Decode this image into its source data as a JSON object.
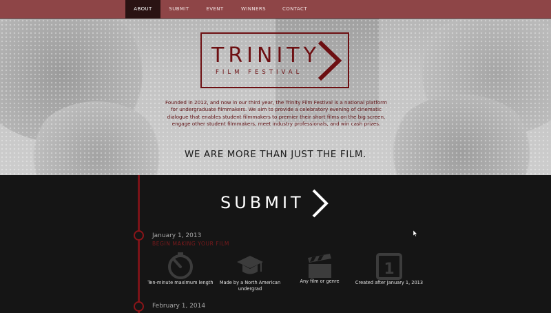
{
  "nav": {
    "items": [
      {
        "label": "ABOUT",
        "active": true
      },
      {
        "label": "SUBMIT",
        "active": false
      },
      {
        "label": "EVENT",
        "active": false
      },
      {
        "label": "WINNERS",
        "active": false
      },
      {
        "label": "CONTACT",
        "active": false
      }
    ]
  },
  "hero": {
    "logo_title": "TRINITY",
    "logo_subtitle": "FILM FESTIVAL",
    "description": "Founded in 2012, and now in our third year, the Trinity Film Festival is a national platform for undergraduate filmmakers. We aim to provide a celebratory evening of cinematic dialogue that enables student filmmakers to premier their short films on the big screen, engage other student filmmakers, meet industry professionals, and win cash prizes.",
    "tagline": "WE ARE MORE THAN JUST THE FILM."
  },
  "submit": {
    "heading": "SUBMIT",
    "timeline": [
      {
        "date": "January 1, 2013",
        "subtitle": "BEGIN MAKING YOUR FILM"
      },
      {
        "date": "February 1, 2014",
        "subtitle": ""
      }
    ],
    "features": [
      {
        "icon": "stopwatch-icon",
        "label": "Ten-minute maximum length"
      },
      {
        "icon": "graduation-cap-icon",
        "label": "Made by a North American undergrad"
      },
      {
        "icon": "clapperboard-icon",
        "label": "Any film or genre"
      },
      {
        "icon": "calendar-one-icon",
        "label": "Created after January 1, 2013",
        "icon_text": "1"
      }
    ]
  },
  "colors": {
    "nav_bg": "#8e4547",
    "nav_active": "#2a1313",
    "brand_red": "#6d0f12",
    "dark_bg": "#151515"
  }
}
